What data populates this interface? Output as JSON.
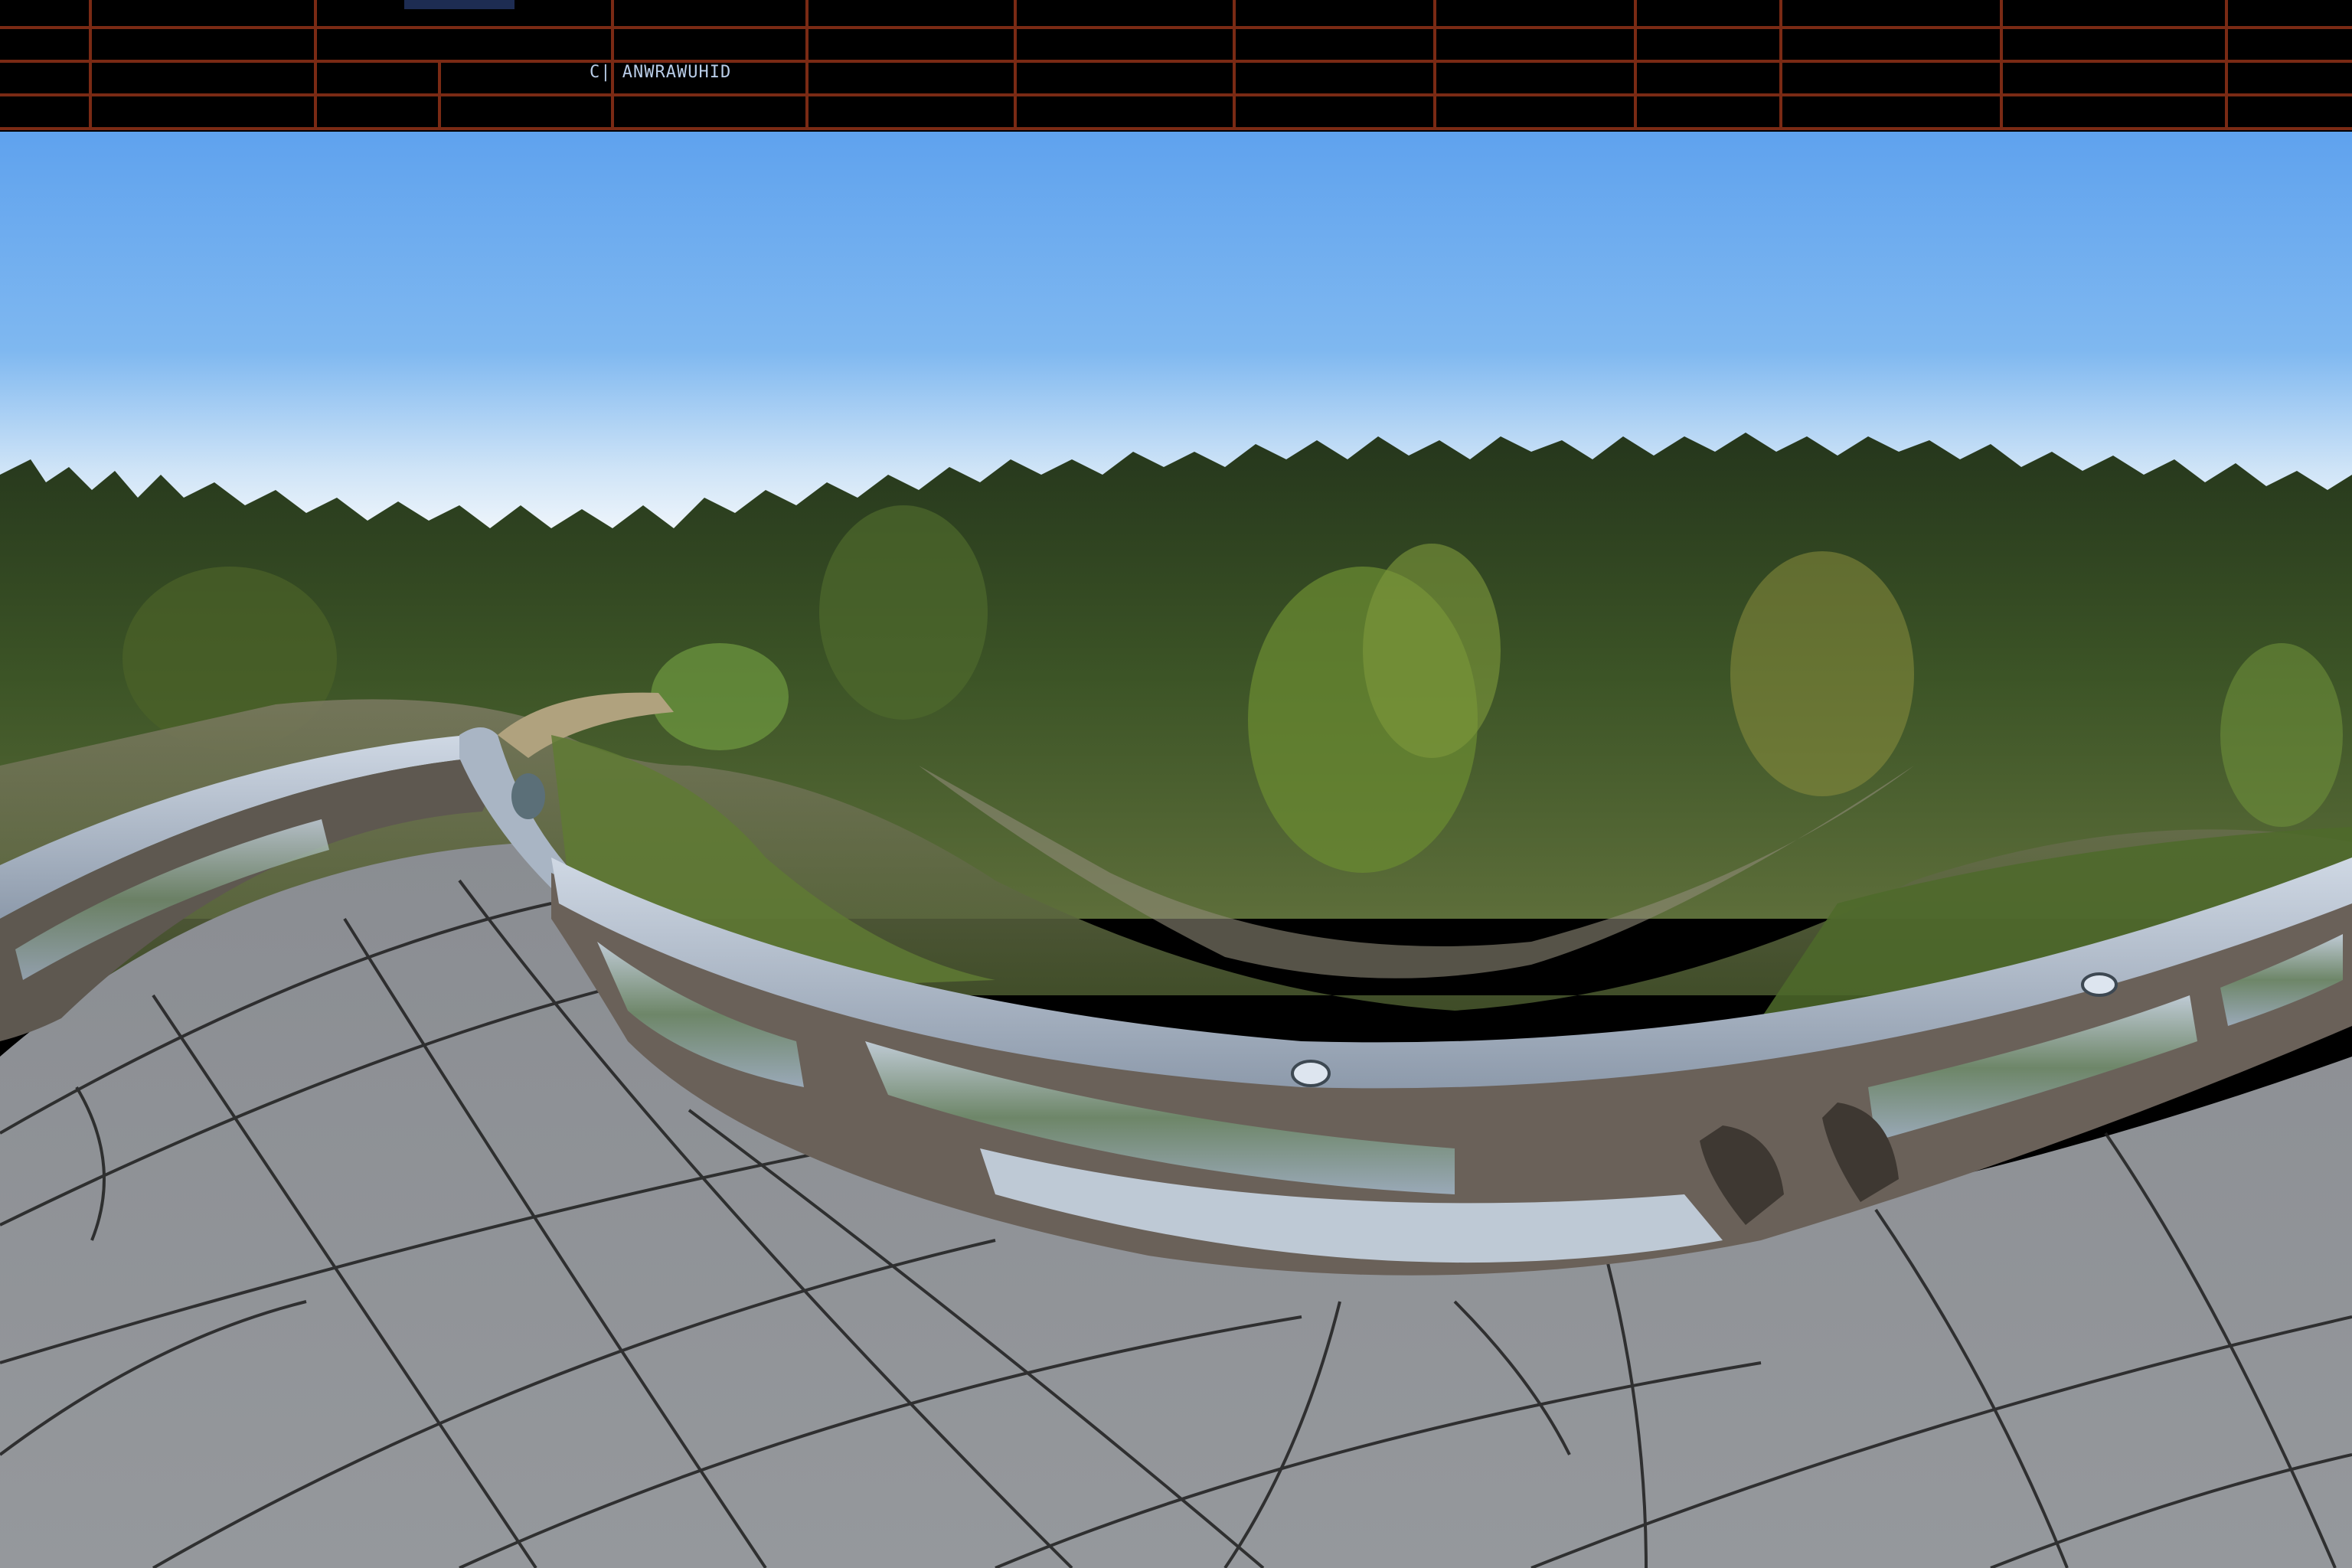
{
  "header_strip": {
    "label": "C| ANWRAWUHID",
    "bg": "#000000",
    "grid_color": "#7a2a14"
  },
  "scene": {
    "sky_top": "#6aa8ee",
    "sky_horizon": "#e8f2fb",
    "forest_dark": "#2d4020",
    "forest_light": "#6f8a35",
    "ground": "#8a7a5a",
    "deck_color": "#8f9296",
    "deck_lines": "#222222",
    "railing_top": "#b7c3d2",
    "railing_body": "#6b625a",
    "glass": "#a9b9c8"
  }
}
